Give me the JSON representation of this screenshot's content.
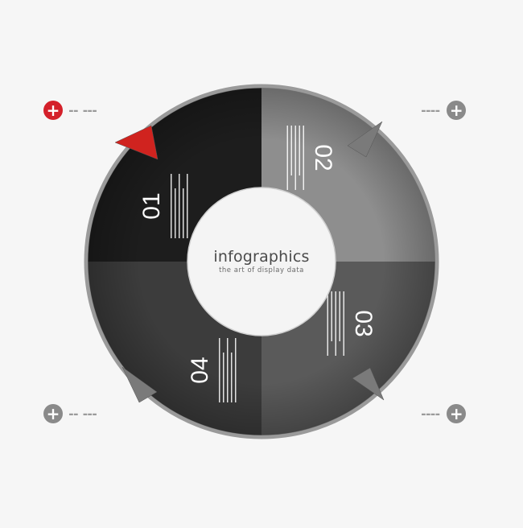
{
  "center": {
    "title": "infographics",
    "subtitle": "the art of display data"
  },
  "segments": [
    {
      "number": "01",
      "color": "#1d1d1d",
      "tab_color": "#d0231f"
    },
    {
      "number": "02",
      "color": "#8e8e8e",
      "tab_color": "#7a7a7a"
    },
    {
      "number": "03",
      "color": "#5a5a5a",
      "tab_color": "#7a7a7a"
    },
    {
      "number": "04",
      "color": "#3c3c3c",
      "tab_color": "#7a7a7a"
    }
  ],
  "corner_buttons": [
    {
      "icon": "plus-icon",
      "color": "#d4202a"
    },
    {
      "icon": "plus-icon",
      "color": "#8a8a8a"
    },
    {
      "icon": "plus-icon",
      "color": "#8a8a8a"
    },
    {
      "icon": "plus-icon",
      "color": "#8a8a8a"
    }
  ],
  "colors": {
    "background": "#f6f6f6",
    "ring_edge": "#8c8c8c",
    "accent": "#d4202a"
  }
}
